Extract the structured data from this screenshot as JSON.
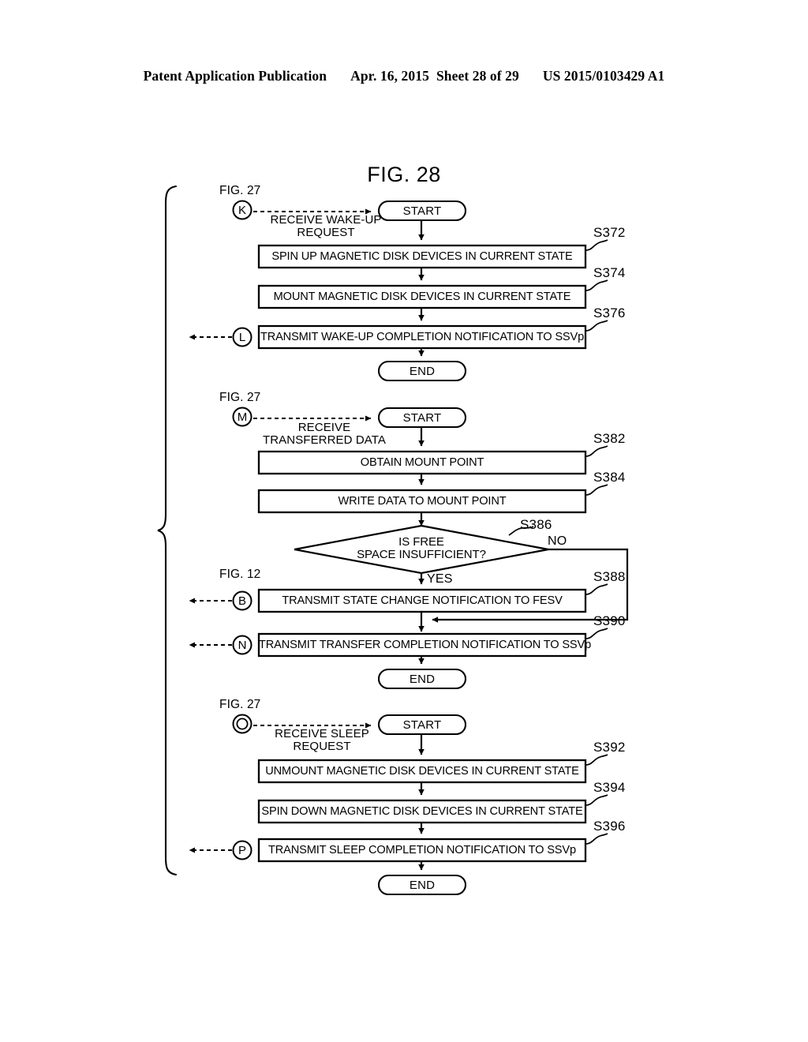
{
  "header": {
    "publication": "Patent Application Publication",
    "date": "Apr. 16, 2015",
    "sheet": "Sheet 28 of 29",
    "number": "US 2015/0103429 A1"
  },
  "figure": {
    "title": "FIG. 28"
  },
  "sections": [
    {
      "id": "wake-up",
      "entry": {
        "source_fig": "FIG. 27",
        "connector": "K",
        "edge_label_line1": "RECEIVE WAKE-UP",
        "edge_label_line2": "REQUEST"
      },
      "start_label": "START",
      "end_label": "END",
      "steps": [
        {
          "step": "S372",
          "text": "SPIN UP MAGNETIC DISK DEVICES IN CURRENT STATE"
        },
        {
          "step": "S374",
          "text": "MOUNT MAGNETIC DISK DEVICES IN CURRENT STATE"
        },
        {
          "step": "S376",
          "text": "TRANSMIT WAKE-UP COMPLETION NOTIFICATION TO SSVp"
        }
      ],
      "exits": [
        {
          "connector": "L",
          "source_fig": ""
        }
      ]
    },
    {
      "id": "transferred-data",
      "entry": {
        "source_fig": "FIG. 27",
        "connector": "M",
        "edge_label_line1": "RECEIVE",
        "edge_label_line2": "TRANSFERRED DATA"
      },
      "start_label": "START",
      "end_label": "END",
      "steps": [
        {
          "step": "S382",
          "text": "OBTAIN MOUNT POINT"
        },
        {
          "step": "S384",
          "text": "WRITE DATA TO MOUNT POINT"
        },
        {
          "step": "S388",
          "text": "TRANSMIT STATE CHANGE NOTIFICATION TO FESV"
        },
        {
          "step": "S390",
          "text": "TRANSMIT TRANSFER COMPLETION NOTIFICATION TO SSVp"
        }
      ],
      "decision": {
        "step": "S386",
        "text_line1": "IS FREE",
        "text_line2": "SPACE INSUFFICIENT?",
        "yes_label": "YES",
        "no_label": "NO"
      },
      "exits": [
        {
          "connector": "B",
          "source_fig": "FIG. 12"
        },
        {
          "connector": "N",
          "source_fig": ""
        }
      ]
    },
    {
      "id": "sleep",
      "entry": {
        "source_fig": "FIG. 27",
        "connector": "O",
        "edge_label_line1": "RECEIVE SLEEP",
        "edge_label_line2": "REQUEST"
      },
      "start_label": "START",
      "end_label": "END",
      "steps": [
        {
          "step": "S392",
          "text": "UNMOUNT MAGNETIC DISK DEVICES IN CURRENT STATE"
        },
        {
          "step": "S394",
          "text": "SPIN DOWN MAGNETIC DISK DEVICES IN CURRENT STATE"
        },
        {
          "step": "S396",
          "text": "TRANSMIT SLEEP COMPLETION NOTIFICATION TO SSVp"
        }
      ],
      "exits": [
        {
          "connector": "P",
          "source_fig": ""
        }
      ]
    }
  ],
  "colors": {
    "ink": "#000000",
    "paper": "#ffffff"
  }
}
